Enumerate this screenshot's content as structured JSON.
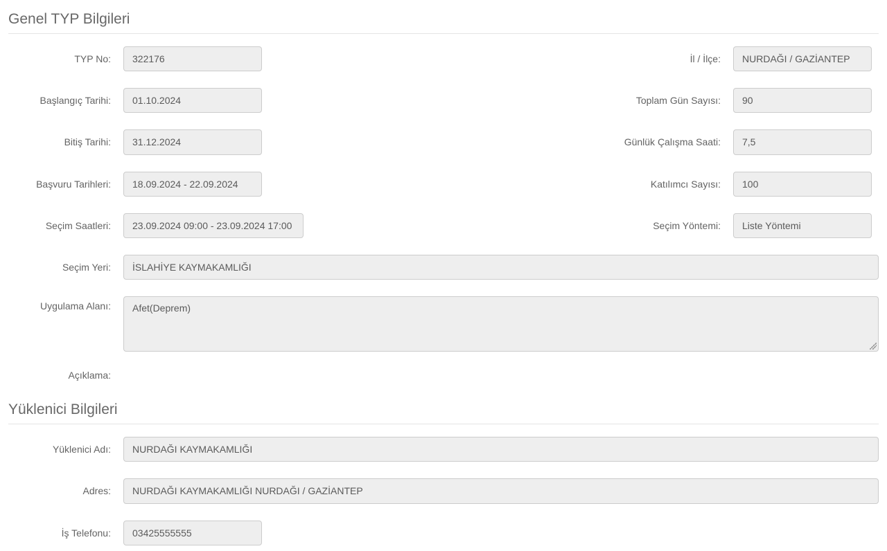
{
  "section1": {
    "title": "Genel TYP Bilgileri",
    "labels": {
      "typNo": "TYP No:",
      "ilIlce": "İl / İlçe:",
      "baslangicTarihi": "Başlangıç Tarihi:",
      "toplamGunSayisi": "Toplam Gün Sayısı:",
      "bitisTarihi": "Bitiş Tarihi:",
      "gunlukCalismaSaati": "Günlük Çalışma Saati:",
      "basvuruTarihleri": "Başvuru Tarihleri:",
      "katilimciSayisi": "Katılımcı Sayısı:",
      "secimSaatleri": "Seçim Saatleri:",
      "secimYontemi": "Seçim Yöntemi:",
      "secimYeri": "Seçim Yeri:",
      "uygulamaAlani": "Uygulama Alanı:",
      "aciklama": "Açıklama:"
    },
    "values": {
      "typNo": "322176",
      "ilIlce": "NURDAĞI / GAZİANTEP",
      "baslangicTarihi": "01.10.2024",
      "toplamGunSayisi": "90",
      "bitisTarihi": "31.12.2024",
      "gunlukCalismaSaati": "7,5",
      "basvuruTarihleri": "18.09.2024 - 22.09.2024",
      "katilimciSayisi": "100",
      "secimSaatleri": "23.09.2024 09:00 - 23.09.2024 17:00",
      "secimYontemi": "Liste Yöntemi",
      "secimYeri": "İSLAHİYE KAYMAKAMLIĞI",
      "uygulamaAlani": "Afet(Deprem)",
      "aciklama": ""
    }
  },
  "section2": {
    "title": "Yüklenici Bilgileri",
    "labels": {
      "yukleniciAdi": "Yüklenici Adı:",
      "adres": "Adres:",
      "isTelefonu": "İş Telefonu:"
    },
    "values": {
      "yukleniciAdi": "NURDAĞI KAYMAKAMLIĞI",
      "adres": "NURDAĞI KAYMAKAMLIĞI NURDAĞI / GAZİANTEP",
      "isTelefonu": "03425555555"
    }
  }
}
